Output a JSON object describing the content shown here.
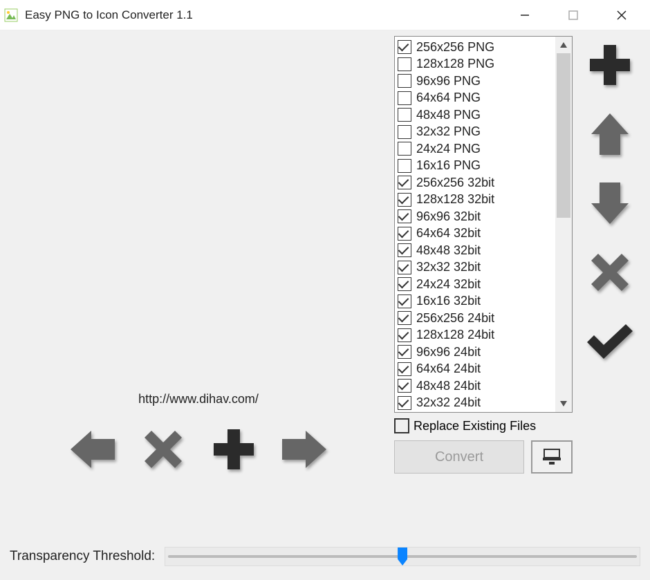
{
  "window": {
    "title": "Easy PNG to Icon Converter 1.1"
  },
  "url": "http://www.dihav.com/",
  "formats": [
    {
      "label": "256x256 PNG",
      "checked": true
    },
    {
      "label": "128x128 PNG",
      "checked": false
    },
    {
      "label": "96x96 PNG",
      "checked": false
    },
    {
      "label": "64x64 PNG",
      "checked": false
    },
    {
      "label": "48x48 PNG",
      "checked": false
    },
    {
      "label": "32x32 PNG",
      "checked": false
    },
    {
      "label": "24x24 PNG",
      "checked": false
    },
    {
      "label": "16x16 PNG",
      "checked": false
    },
    {
      "label": "256x256 32bit",
      "checked": true
    },
    {
      "label": "128x128 32bit",
      "checked": true
    },
    {
      "label": "96x96 32bit",
      "checked": true
    },
    {
      "label": "64x64 32bit",
      "checked": true
    },
    {
      "label": "48x48 32bit",
      "checked": true
    },
    {
      "label": "32x32 32bit",
      "checked": true
    },
    {
      "label": "24x24 32bit",
      "checked": true
    },
    {
      "label": "16x16 32bit",
      "checked": true
    },
    {
      "label": "256x256 24bit",
      "checked": true
    },
    {
      "label": "128x128 24bit",
      "checked": true
    },
    {
      "label": "96x96 24bit",
      "checked": true
    },
    {
      "label": "64x64 24bit",
      "checked": true
    },
    {
      "label": "48x48 24bit",
      "checked": true
    },
    {
      "label": "32x32 24bit",
      "checked": true
    }
  ],
  "replace_existing": {
    "label": "Replace Existing Files",
    "checked": false
  },
  "convert_label": "Convert",
  "threshold": {
    "label": "Transparency Threshold:",
    "value_percent": 50
  },
  "colors": {
    "gray_icon": "#666666",
    "dark_icon": "#2b2b2b",
    "accent": "#0a84ff"
  }
}
